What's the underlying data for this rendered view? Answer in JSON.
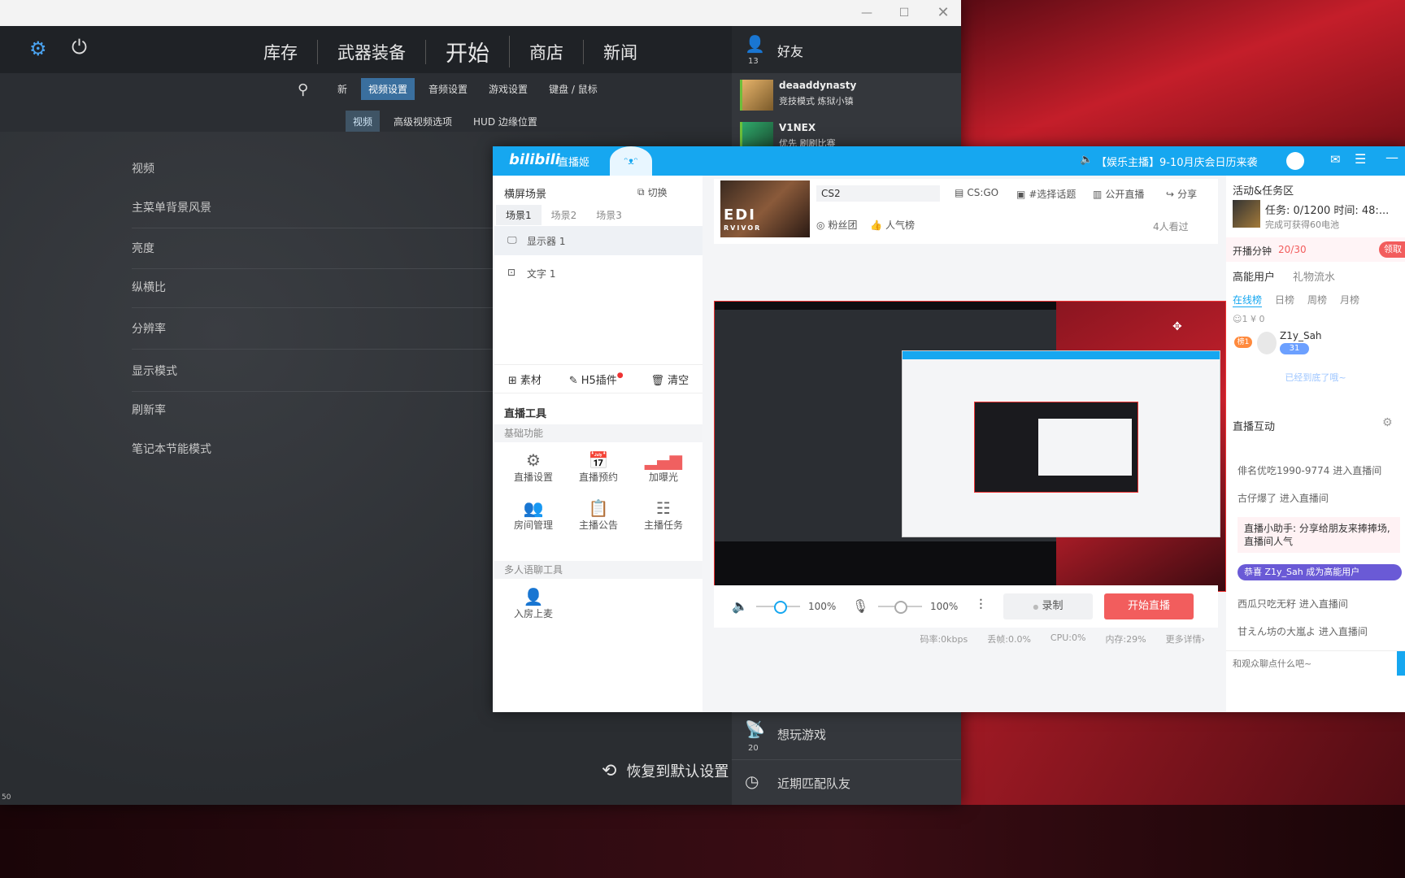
{
  "cs": {
    "nav": [
      "库存",
      "武器装备",
      "开始",
      "商店",
      "新闻"
    ],
    "subnav": [
      "新",
      "视频设置",
      "音频设置",
      "游戏设置",
      "键盘 / 鼠标"
    ],
    "subnav_active": "视频设置",
    "subnav2": [
      "视频",
      "高级视频选项",
      "HUD 边缘位置"
    ],
    "subnav2_active": "视频",
    "rows": [
      "视频",
      "主菜单背景风景",
      "亮度",
      "纵横比",
      "分辨率",
      "显示模式",
      "刷新率",
      "笔记本节能模式"
    ],
    "restore_label": "恢复到默认设置",
    "corner_num": "50"
  },
  "friends": {
    "title": "好友",
    "count": "13",
    "list": [
      {
        "name": "deaaddynasty",
        "sub": "竞技模式 炼狱小镇"
      },
      {
        "name": "V1NEX",
        "sub": "优先 刷刷比赛"
      }
    ],
    "bottom1": "想玩游戏",
    "bottom1_count": "20",
    "bottom2": "近期匹配队友"
  },
  "bili": {
    "app_name": "直播姬",
    "logo": "bilibili",
    "announce": "【娱乐主播】9-10月庆会日历来袭",
    "scene_title": "横屏场景",
    "switch_label": "切换",
    "scene_tabs": [
      "场景1",
      "场景2",
      "场景3"
    ],
    "sources": [
      "显示器 1",
      "文字 1"
    ],
    "src_actions": [
      "素材",
      "H5插件",
      "清空"
    ],
    "tools_title": "直播工具",
    "basic_title": "基础功能",
    "tools": [
      "直播设置",
      "直播预约",
      "加曝光",
      "房间管理",
      "主播公告",
      "主播任务"
    ],
    "multi_title": "多人语聊工具",
    "multi_tools": [
      "入房上麦"
    ],
    "stream_title": "CS2",
    "category": "CS:GO",
    "topic": "#选择话题",
    "public": "公开直播",
    "share": "分享",
    "fans": "粉丝团",
    "popular": "人气榜",
    "viewers": "4人看过",
    "cover_text": "EDI",
    "cover_sub": "RVIVOR",
    "vol1": "100%",
    "vol2": "100%",
    "record": "录制",
    "start": "开始直播",
    "status": [
      "码率:0kbps",
      "丢帧:0.0%",
      "CPU:0%",
      "内存:29%",
      "更多详情"
    ],
    "right": {
      "activity_title": "活动&任务区",
      "task": "任务: 0/1200 时间: 48:...",
      "task_sub": "完成可获得60电池",
      "minutes_label": "开播分钟",
      "minutes_val": "20/30",
      "claim": "领取",
      "tabs": [
        "高能用户",
        "礼物流水"
      ],
      "subtabs": [
        "在线榜",
        "日榜",
        "周榜",
        "月榜"
      ],
      "stats": "1  ¥ 0",
      "top_user": "Z1y_Sah",
      "top_badge": "榜1",
      "top_level": "31",
      "end_text": "已经到底了哦~",
      "interact_title": "直播互动",
      "msgs": [
        "俳名优吃1990-9774 进入直播间",
        "古仔爆了 进入直播间",
        "直播小助手: 分享给朋友来捧捧场, 直播间人气",
        "恭喜 Z1y_Sah 成为高能用户",
        "西瓜只吃无籽 进入直播间",
        "甘えん坊の大嵐よ 进入直播间"
      ],
      "input_placeholder": "和观众聊点什么吧~"
    }
  }
}
